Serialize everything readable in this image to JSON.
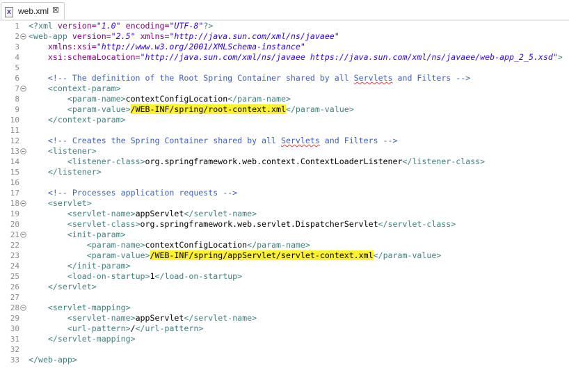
{
  "tab": {
    "label": "web.xml",
    "close": "⊠"
  },
  "lines": [
    {
      "n": "1",
      "fold": false,
      "parts": [
        {
          "t": "<?xml ",
          "c": "tag"
        },
        {
          "t": "version=",
          "c": "attr"
        },
        {
          "t": "\"1.0\"",
          "c": "val"
        },
        {
          "t": " ",
          "c": "txt"
        },
        {
          "t": "encoding=",
          "c": "attr"
        },
        {
          "t": "\"UTF-8\"",
          "c": "val"
        },
        {
          "t": "?>",
          "c": "tag"
        }
      ]
    },
    {
      "n": "2",
      "fold": true,
      "parts": [
        {
          "t": "<web-app ",
          "c": "tag"
        },
        {
          "t": "version=",
          "c": "attr"
        },
        {
          "t": "\"2.5\"",
          "c": "val"
        },
        {
          "t": " ",
          "c": "txt"
        },
        {
          "t": "xmlns=",
          "c": "attr"
        },
        {
          "t": "\"http://java.sun.com/xml/ns/javaee\"",
          "c": "val"
        }
      ]
    },
    {
      "n": "3",
      "fold": false,
      "parts": [
        {
          "t": "    ",
          "c": "txt"
        },
        {
          "t": "xmlns:xsi=",
          "c": "attr"
        },
        {
          "t": "\"http://www.w3.org/2001/XMLSchema-instance\"",
          "c": "val"
        }
      ]
    },
    {
      "n": "4",
      "fold": false,
      "parts": [
        {
          "t": "    ",
          "c": "txt"
        },
        {
          "t": "xsi:schemaLocation=",
          "c": "attr"
        },
        {
          "t": "\"http://java.sun.com/xml/ns/javaee https://java.sun.com/xml/ns/javaee/web-app_2_5.xsd\"",
          "c": "val"
        },
        {
          "t": ">",
          "c": "tag"
        }
      ]
    },
    {
      "n": "5",
      "fold": false,
      "parts": []
    },
    {
      "n": "6",
      "fold": false,
      "parts": [
        {
          "t": "    ",
          "c": "txt"
        },
        {
          "t": "<!-- The definition of the Root Spring Container shared by all ",
          "c": "com"
        },
        {
          "t": "Servlets",
          "c": "com-sq"
        },
        {
          "t": " and Filters -->",
          "c": "com"
        }
      ]
    },
    {
      "n": "7",
      "fold": true,
      "parts": [
        {
          "t": "    ",
          "c": "txt"
        },
        {
          "t": "<context-param>",
          "c": "tag"
        }
      ]
    },
    {
      "n": "8",
      "fold": false,
      "parts": [
        {
          "t": "        ",
          "c": "txt"
        },
        {
          "t": "<param-name>",
          "c": "tag"
        },
        {
          "t": "contextConfigLocation",
          "c": "txt"
        },
        {
          "t": "</param-name>",
          "c": "tag"
        }
      ]
    },
    {
      "n": "9",
      "fold": false,
      "parts": [
        {
          "t": "        ",
          "c": "txt"
        },
        {
          "t": "<param-value>",
          "c": "tag"
        },
        {
          "t": "/WEB-INF/spring/root-context.xml",
          "c": "hl"
        },
        {
          "t": "</param-value>",
          "c": "tag"
        }
      ]
    },
    {
      "n": "10",
      "fold": false,
      "parts": [
        {
          "t": "    ",
          "c": "txt"
        },
        {
          "t": "</context-param>",
          "c": "tag"
        }
      ]
    },
    {
      "n": "11",
      "fold": false,
      "parts": []
    },
    {
      "n": "12",
      "fold": false,
      "parts": [
        {
          "t": "    ",
          "c": "txt"
        },
        {
          "t": "<!-- Creates the Spring Container shared by all ",
          "c": "com"
        },
        {
          "t": "Servlets",
          "c": "com-sq"
        },
        {
          "t": " and Filters -->",
          "c": "com"
        }
      ]
    },
    {
      "n": "13",
      "fold": true,
      "parts": [
        {
          "t": "    ",
          "c": "txt"
        },
        {
          "t": "<listener>",
          "c": "tag"
        }
      ]
    },
    {
      "n": "14",
      "fold": false,
      "parts": [
        {
          "t": "        ",
          "c": "txt"
        },
        {
          "t": "<listener-class>",
          "c": "tag"
        },
        {
          "t": "org.springframework.web.context.ContextLoaderListener",
          "c": "txt"
        },
        {
          "t": "</listener-class>",
          "c": "tag"
        }
      ]
    },
    {
      "n": "15",
      "fold": false,
      "parts": [
        {
          "t": "    ",
          "c": "txt"
        },
        {
          "t": "</listener>",
          "c": "tag"
        }
      ]
    },
    {
      "n": "16",
      "fold": false,
      "parts": []
    },
    {
      "n": "17",
      "fold": false,
      "parts": [
        {
          "t": "    ",
          "c": "txt"
        },
        {
          "t": "<!-- Processes application requests -->",
          "c": "com"
        }
      ]
    },
    {
      "n": "18",
      "fold": true,
      "parts": [
        {
          "t": "    ",
          "c": "txt"
        },
        {
          "t": "<servlet>",
          "c": "tag"
        }
      ]
    },
    {
      "n": "19",
      "fold": false,
      "parts": [
        {
          "t": "        ",
          "c": "txt"
        },
        {
          "t": "<servlet-name>",
          "c": "tag"
        },
        {
          "t": "appServlet",
          "c": "txt"
        },
        {
          "t": "</servlet-name>",
          "c": "tag"
        }
      ]
    },
    {
      "n": "20",
      "fold": false,
      "parts": [
        {
          "t": "        ",
          "c": "txt"
        },
        {
          "t": "<servlet-class>",
          "c": "tag"
        },
        {
          "t": "org.springframework.web.servlet.DispatcherServlet",
          "c": "txt"
        },
        {
          "t": "</servlet-class>",
          "c": "tag"
        }
      ]
    },
    {
      "n": "21",
      "fold": true,
      "parts": [
        {
          "t": "        ",
          "c": "txt"
        },
        {
          "t": "<init-param>",
          "c": "tag"
        }
      ]
    },
    {
      "n": "22",
      "fold": false,
      "parts": [
        {
          "t": "            ",
          "c": "txt"
        },
        {
          "t": "<param-name>",
          "c": "tag"
        },
        {
          "t": "contextConfigLocation",
          "c": "txt"
        },
        {
          "t": "</param-name>",
          "c": "tag"
        }
      ]
    },
    {
      "n": "23",
      "fold": false,
      "parts": [
        {
          "t": "            ",
          "c": "txt"
        },
        {
          "t": "<param-value>",
          "c": "tag"
        },
        {
          "t": "/WEB-INF/spring/appServlet/servlet-context.xml",
          "c": "hl"
        },
        {
          "t": "</param-value>",
          "c": "tag"
        }
      ]
    },
    {
      "n": "24",
      "fold": false,
      "parts": [
        {
          "t": "        ",
          "c": "txt"
        },
        {
          "t": "</init-param>",
          "c": "tag"
        }
      ]
    },
    {
      "n": "25",
      "fold": false,
      "parts": [
        {
          "t": "        ",
          "c": "txt"
        },
        {
          "t": "<load-on-startup>",
          "c": "tag"
        },
        {
          "t": "1",
          "c": "txt"
        },
        {
          "t": "</load-on-startup>",
          "c": "tag"
        }
      ]
    },
    {
      "n": "26",
      "fold": false,
      "parts": [
        {
          "t": "    ",
          "c": "txt"
        },
        {
          "t": "</servlet>",
          "c": "tag"
        }
      ]
    },
    {
      "n": "27",
      "fold": false,
      "parts": []
    },
    {
      "n": "28",
      "fold": true,
      "parts": [
        {
          "t": "    ",
          "c": "txt"
        },
        {
          "t": "<servlet-mapping>",
          "c": "tag"
        }
      ]
    },
    {
      "n": "29",
      "fold": false,
      "parts": [
        {
          "t": "        ",
          "c": "txt"
        },
        {
          "t": "<servlet-name>",
          "c": "tag"
        },
        {
          "t": "appServlet",
          "c": "txt"
        },
        {
          "t": "</servlet-name>",
          "c": "tag"
        }
      ]
    },
    {
      "n": "30",
      "fold": false,
      "parts": [
        {
          "t": "        ",
          "c": "txt"
        },
        {
          "t": "<url-pattern>",
          "c": "tag"
        },
        {
          "t": "/",
          "c": "txt"
        },
        {
          "t": "</url-pattern>",
          "c": "tag"
        }
      ]
    },
    {
      "n": "31",
      "fold": false,
      "parts": [
        {
          "t": "    ",
          "c": "txt"
        },
        {
          "t": "</servlet-mapping>",
          "c": "tag"
        }
      ]
    },
    {
      "n": "32",
      "fold": false,
      "parts": []
    },
    {
      "n": "33",
      "fold": false,
      "parts": [
        {
          "t": "</web-app>",
          "c": "tag"
        }
      ]
    }
  ]
}
